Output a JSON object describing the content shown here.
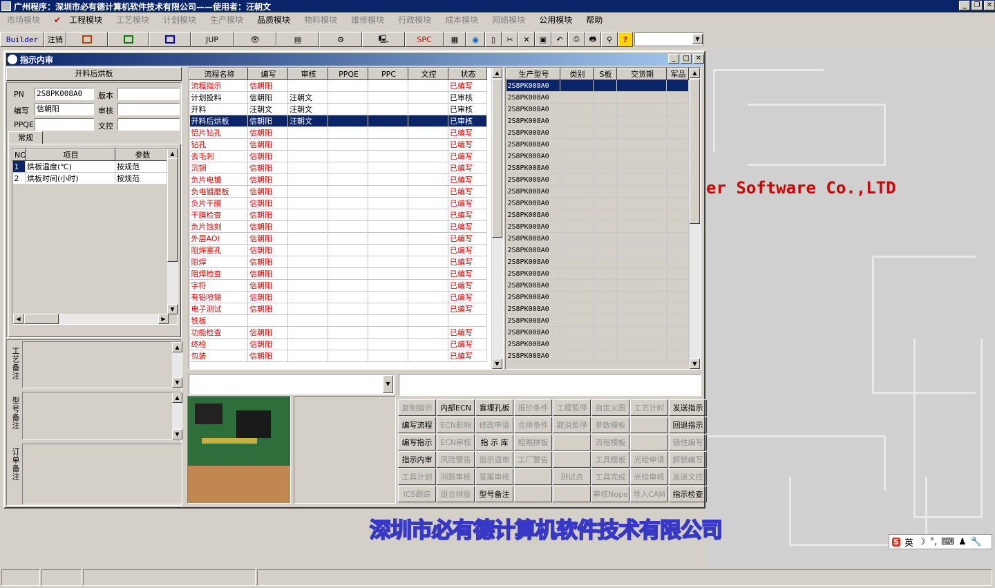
{
  "app_title": "广州程序：深圳市必有德计算机软件技术有限公司——使用者：汪朝文",
  "menu": [
    {
      "label": "市场模块",
      "enabled": false
    },
    {
      "label": "工程模块",
      "enabled": true,
      "checked": true
    },
    {
      "label": "工艺模块",
      "enabled": false
    },
    {
      "label": "计划模块",
      "enabled": false
    },
    {
      "label": "生产模块",
      "enabled": false
    },
    {
      "label": "品质模块",
      "enabled": true
    },
    {
      "label": "物料模块",
      "enabled": false
    },
    {
      "label": "维修模块",
      "enabled": false
    },
    {
      "label": "行政模块",
      "enabled": false
    },
    {
      "label": "成本模块",
      "enabled": false
    },
    {
      "label": "网络模块",
      "enabled": false
    },
    {
      "label": "公用模块",
      "enabled": true
    },
    {
      "label": "帮助",
      "enabled": true
    }
  ],
  "toolbar": {
    "builder": "Builder",
    "logout": "注销",
    "jup": "JUP",
    "spc": "SPC",
    "help": "?"
  },
  "desktop": {
    "brand_en": "er Software Co.,LTD",
    "brand_zh": "深圳市必有德计算机软件技术有限公司",
    "ime_label": "英"
  },
  "window": {
    "title": "指示内审"
  },
  "left": {
    "process_name": "开料后烘板",
    "pn_label": "PN",
    "pn_value": "2S8PK008A0",
    "version_label": "版本",
    "version_value": "",
    "author_label": "编写",
    "author_value": "信朝阳",
    "review_label": "审核",
    "review_value": "",
    "ppqe_label": "PPQE",
    "ppqe_value": "",
    "control_label": "文控",
    "control_value": "",
    "tab": "常规",
    "param_headers": [
      "NO",
      "项目",
      "参数"
    ],
    "params": [
      {
        "no": "1",
        "item": "烘板温度(℃)",
        "value": "按规范"
      },
      {
        "no": "2",
        "item": "烘板时间(小时)",
        "value": "按规范"
      }
    ],
    "notes": [
      "工艺备注",
      "型号备注",
      "订单备注"
    ]
  },
  "flow_headers": [
    "流程名称",
    "编写",
    "审核",
    "PPQE",
    "PPC",
    "文控",
    "状态"
  ],
  "flows": [
    {
      "name": "流程指示",
      "author": "信朝阳",
      "review": "",
      "status": "已编写",
      "red": true
    },
    {
      "name": "计划投料",
      "author": "信朝阳",
      "review": "汪朝文",
      "status": "已审核",
      "red": false
    },
    {
      "name": "开料",
      "author": "汪朝文",
      "review": "汪朝文",
      "status": "已审核",
      "red": false
    },
    {
      "name": "开料后烘板",
      "author": "信朝阳",
      "review": "汪朝文",
      "status": "已审核",
      "red": false,
      "selected": true
    },
    {
      "name": "铝片钻孔",
      "author": "信朝阳",
      "review": "",
      "status": "已编写",
      "red": true
    },
    {
      "name": "钻孔",
      "author": "信朝阳",
      "review": "",
      "status": "已编写",
      "red": true
    },
    {
      "name": "去毛刺",
      "author": "信朝阳",
      "review": "",
      "status": "已编写",
      "red": true
    },
    {
      "name": "沉铜",
      "author": "信朝阳",
      "review": "",
      "status": "已编写",
      "red": true
    },
    {
      "name": "负片电镀",
      "author": "信朝阳",
      "review": "",
      "status": "已编写",
      "red": true
    },
    {
      "name": "负电镀磨板",
      "author": "信朝阳",
      "review": "",
      "status": "已编写",
      "red": true
    },
    {
      "name": "负片干膜",
      "author": "信朝阳",
      "review": "",
      "status": "已编写",
      "red": true
    },
    {
      "name": "干膜检查",
      "author": "信朝阳",
      "review": "",
      "status": "已编写",
      "red": true
    },
    {
      "name": "负片蚀刻",
      "author": "信朝阳",
      "review": "",
      "status": "已编写",
      "red": true
    },
    {
      "name": "外层AOI",
      "author": "信朝阳",
      "review": "",
      "status": "已编写",
      "red": true
    },
    {
      "name": "阻焊塞孔",
      "author": "信朝阳",
      "review": "",
      "status": "已编写",
      "red": true
    },
    {
      "name": "阻焊",
      "author": "信朝阳",
      "review": "",
      "status": "已编写",
      "red": true
    },
    {
      "name": "阻焊检查",
      "author": "信朝阳",
      "review": "",
      "status": "已编写",
      "red": true
    },
    {
      "name": "字符",
      "author": "信朝阳",
      "review": "",
      "status": "已编写",
      "red": true
    },
    {
      "name": "有铅喷锡",
      "author": "信朝阳",
      "review": "",
      "status": "已编写",
      "red": true
    },
    {
      "name": "电子测试",
      "author": "信朝阳",
      "review": "",
      "status": "已编写",
      "red": true
    },
    {
      "name": "铣板",
      "author": "",
      "review": "",
      "status": "",
      "red": true
    },
    {
      "name": "功能检查",
      "author": "信朝阳",
      "review": "",
      "status": "已编写",
      "red": true
    },
    {
      "name": "终检",
      "author": "信朝阳",
      "review": "",
      "status": "已编写",
      "red": true
    },
    {
      "name": "包装",
      "author": "信朝阳",
      "review": "",
      "status": "已编写",
      "red": true
    }
  ],
  "model_headers": [
    "生产型号",
    "类别",
    "S板",
    "交货期",
    "军品"
  ],
  "model_value": "2S8PK008A0",
  "model_rows": 24,
  "buttons": [
    {
      "label": "复制指示",
      "enabled": false
    },
    {
      "label": "内部ECN",
      "enabled": true
    },
    {
      "label": "盲埋孔板",
      "enabled": true
    },
    {
      "label": "报价条件",
      "enabled": false
    },
    {
      "label": "工程暂停",
      "enabled": false
    },
    {
      "label": "自定义图",
      "enabled": false
    },
    {
      "label": "工艺计时",
      "enabled": false
    },
    {
      "label": "发送指示",
      "enabled": true
    },
    {
      "label": "编写流程",
      "enabled": true
    },
    {
      "label": "ECN影响",
      "enabled": false
    },
    {
      "label": "修改申请",
      "enabled": false
    },
    {
      "label": "合拼条件",
      "enabled": false
    },
    {
      "label": "取消暂停",
      "enabled": false
    },
    {
      "label": "参数模板",
      "enabled": false
    },
    {
      "label": "",
      "enabled": false
    },
    {
      "label": "回退指示",
      "enabled": true
    },
    {
      "label": "编写指示",
      "enabled": true
    },
    {
      "label": "ECN审核",
      "enabled": false
    },
    {
      "label": "指 示 库",
      "enabled": true
    },
    {
      "label": "粗略拼板",
      "enabled": false
    },
    {
      "label": "",
      "enabled": false
    },
    {
      "label": "流程模板",
      "enabled": false
    },
    {
      "label": "",
      "enabled": false
    },
    {
      "label": "锁住编写",
      "enabled": false
    },
    {
      "label": "指示内审",
      "enabled": true
    },
    {
      "label": "风险警告",
      "enabled": false
    },
    {
      "label": "指示退审",
      "enabled": false
    },
    {
      "label": "工厂警告",
      "enabled": false
    },
    {
      "label": "",
      "enabled": false
    },
    {
      "label": "工具模板",
      "enabled": false
    },
    {
      "label": "光绘申请",
      "enabled": false
    },
    {
      "label": "解锁编写",
      "enabled": false
    },
    {
      "label": "工具计划",
      "enabled": false
    },
    {
      "label": "问题审核",
      "enabled": false
    },
    {
      "label": "答案审核",
      "enabled": false
    },
    {
      "label": "",
      "enabled": false
    },
    {
      "label": "测试点",
      "enabled": false
    },
    {
      "label": "工具完成",
      "enabled": false
    },
    {
      "label": "光绘审核",
      "enabled": false
    },
    {
      "label": "发送文控",
      "enabled": false
    },
    {
      "label": "ICS跟踪",
      "enabled": false
    },
    {
      "label": "组合排版",
      "enabled": false
    },
    {
      "label": "型号备注",
      "enabled": true
    },
    {
      "label": "",
      "enabled": false
    },
    {
      "label": "",
      "enabled": false
    },
    {
      "label": "审核Nope",
      "enabled": false
    },
    {
      "label": "导入CAM",
      "enabled": false
    },
    {
      "label": "指示检查",
      "enabled": true
    }
  ]
}
